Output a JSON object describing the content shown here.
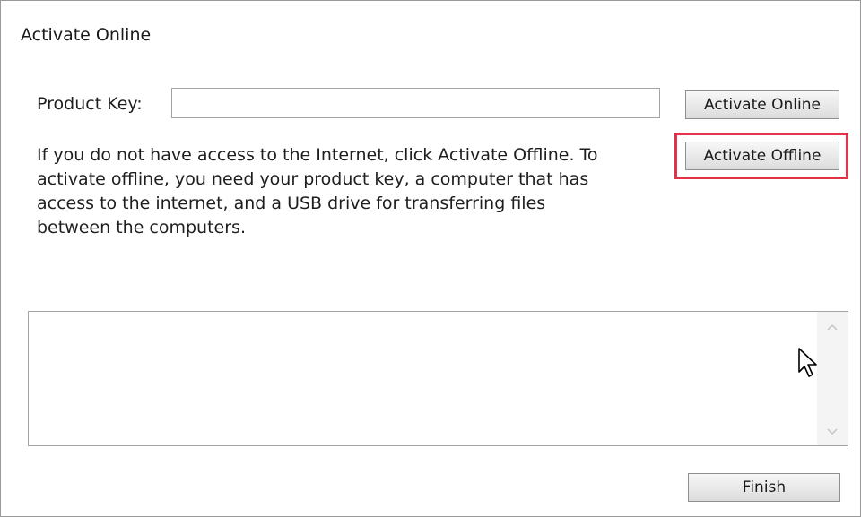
{
  "dialog": {
    "title": "Activate Online"
  },
  "product_key": {
    "label": "Product Key:",
    "value": "",
    "placeholder": ""
  },
  "buttons": {
    "activate_online": "Activate Online",
    "activate_offline": "Activate Offline",
    "finish": "Finish"
  },
  "info_lines": [
    "If you do not have access to the Internet, click Activate Offline. To",
    "activate offline, you need your product key, a computer that has",
    "access to the internet, and a USB drive for transferring files",
    "between the computers."
  ],
  "log": {
    "text": "",
    "scroll_up_icon": "chevron-up-icon",
    "scroll_down_icon": "chevron-down-icon"
  },
  "colors": {
    "highlight": "#e0334a",
    "button_border": "#8f8f8f"
  }
}
